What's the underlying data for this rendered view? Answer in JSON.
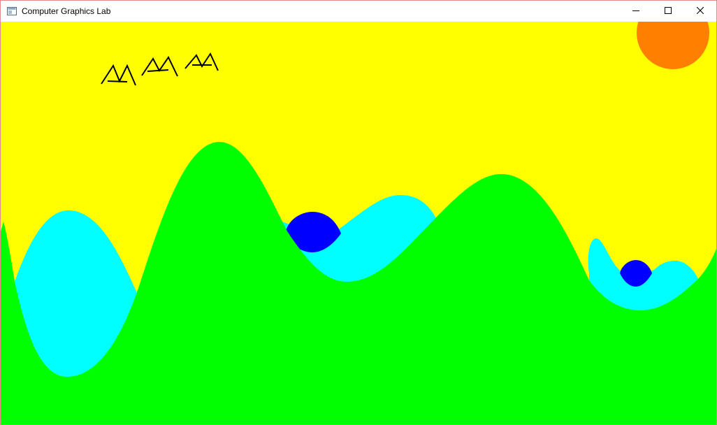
{
  "window": {
    "title": "Computer Graphics Lab",
    "app_icon": "window-app-icon",
    "controls": {
      "minimize_icon": "minimize-icon",
      "maximize_icon": "maximize-icon",
      "close_icon": "close-icon"
    }
  },
  "scene": {
    "sky_color": "#ffff00",
    "sun_color": "#ff8000",
    "hills_color": "#00ff00",
    "water_color": "#00ffff",
    "ball_color": "#0000ff",
    "bird_color": "#000000",
    "bird_count": 3
  }
}
